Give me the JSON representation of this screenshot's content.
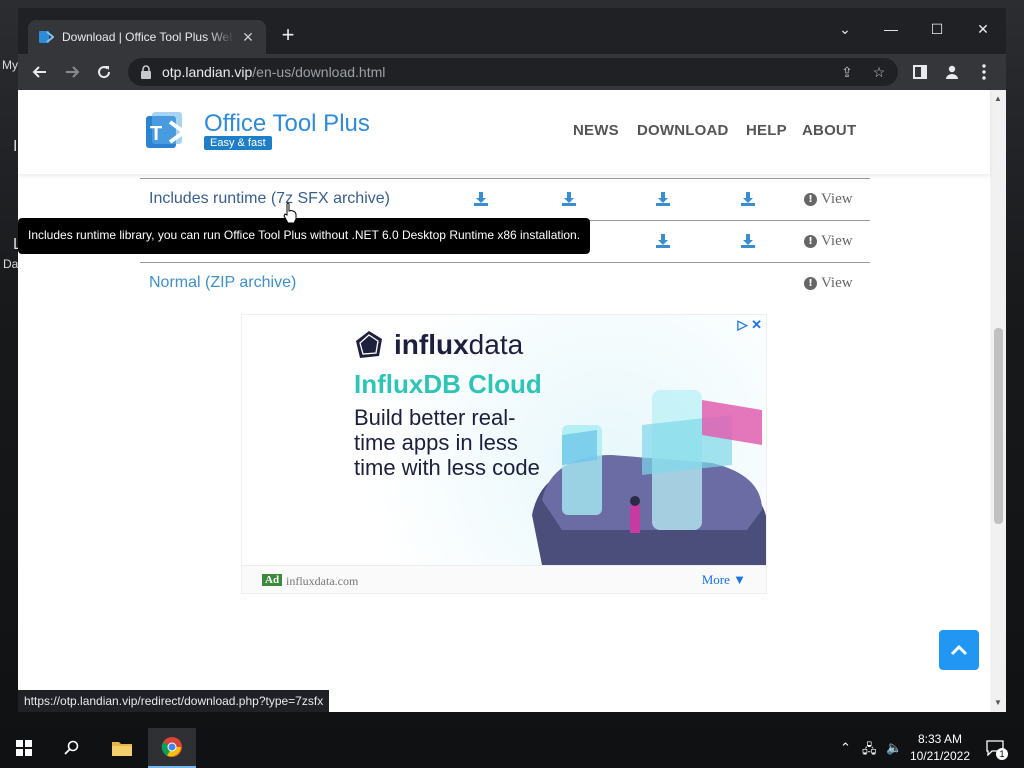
{
  "desktop": {
    "labels": [
      "My",
      "I",
      "L",
      "Da"
    ]
  },
  "browser": {
    "tab": {
      "title": "Download | Office Tool Plus Website",
      "favicon": "otp-favicon"
    },
    "window_controls": [
      "minimize",
      "maximize",
      "close"
    ],
    "url_host": "otp.landian.vip",
    "url_path": "/en-us/download.html",
    "status_url": "https://otp.landian.vip/redirect/download.php?type=7zsfx"
  },
  "site": {
    "brand": "Office Tool Plus",
    "tagline": "Easy & fast",
    "nav": [
      "NEWS",
      "DOWNLOAD",
      "HELP",
      "ABOUT"
    ]
  },
  "downloads": {
    "rows": [
      {
        "label": "Includes runtime (7z SFX archive)",
        "link_color": "#3a5f8a",
        "view": "View"
      },
      {
        "label": "",
        "view": "View"
      },
      {
        "label": "Normal (ZIP archive)",
        "link_color": "#3f8fc9",
        "view": "View"
      }
    ],
    "tooltip": "Includes runtime library, you can run Office Tool Plus without .NET 6.0 Desktop Runtime x86 installation."
  },
  "ad": {
    "brand_bold": "influx",
    "brand_light": "data",
    "headline": "InfluxDB Cloud",
    "body": "Build better real-time apps in less time with less code",
    "badge": "Ad",
    "domain": "influxdata.com",
    "more": "More ▼"
  },
  "taskbar": {
    "time": "8:33 AM",
    "date": "10/21/2022",
    "notifications": "1"
  },
  "colors": {
    "accent": "#2f8bd8",
    "download_icon": "#3a8ed0",
    "back_to_top": "#2196f3"
  }
}
